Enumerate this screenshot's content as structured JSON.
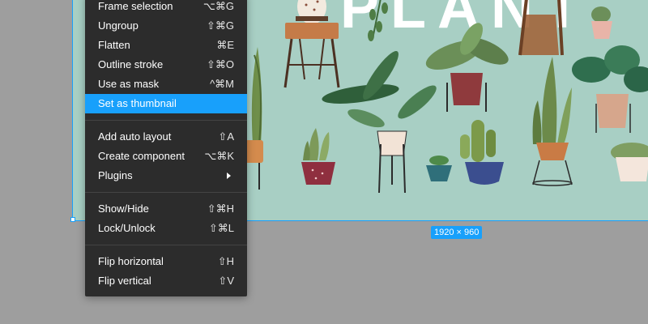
{
  "frame": {
    "title_text": "PLANT",
    "dimensions_label": "1920 × 960",
    "background_color": "#a8cfc4",
    "selection_color": "#18a0fb"
  },
  "context_menu": {
    "groups": [
      [
        {
          "label": "Frame selection",
          "shortcut": "⌥⌘G"
        },
        {
          "label": "Ungroup",
          "shortcut": "⇧⌘G"
        },
        {
          "label": "Flatten",
          "shortcut": "⌘E"
        },
        {
          "label": "Outline stroke",
          "shortcut": "⇧⌘O"
        },
        {
          "label": "Use as mask",
          "shortcut": "^⌘M"
        },
        {
          "label": "Set as thumbnail",
          "shortcut": "",
          "highlighted": true
        }
      ],
      [
        {
          "label": "Add auto layout",
          "shortcut": "⇧A"
        },
        {
          "label": "Create component",
          "shortcut": "⌥⌘K"
        },
        {
          "label": "Plugins",
          "shortcut": "",
          "icon": "submenu-arrow-icon"
        }
      ],
      [
        {
          "label": "Show/Hide",
          "shortcut": "⇧⌘H"
        },
        {
          "label": "Lock/Unlock",
          "shortcut": "⇧⌘L"
        }
      ],
      [
        {
          "label": "Flip horizontal",
          "shortcut": "⇧H"
        },
        {
          "label": "Flip vertical",
          "shortcut": "⇧V"
        }
      ]
    ]
  },
  "colors": {
    "menu_background": "#2c2c2c",
    "menu_highlight": "#18a0fb",
    "canvas_background": "#9e9e9e"
  }
}
